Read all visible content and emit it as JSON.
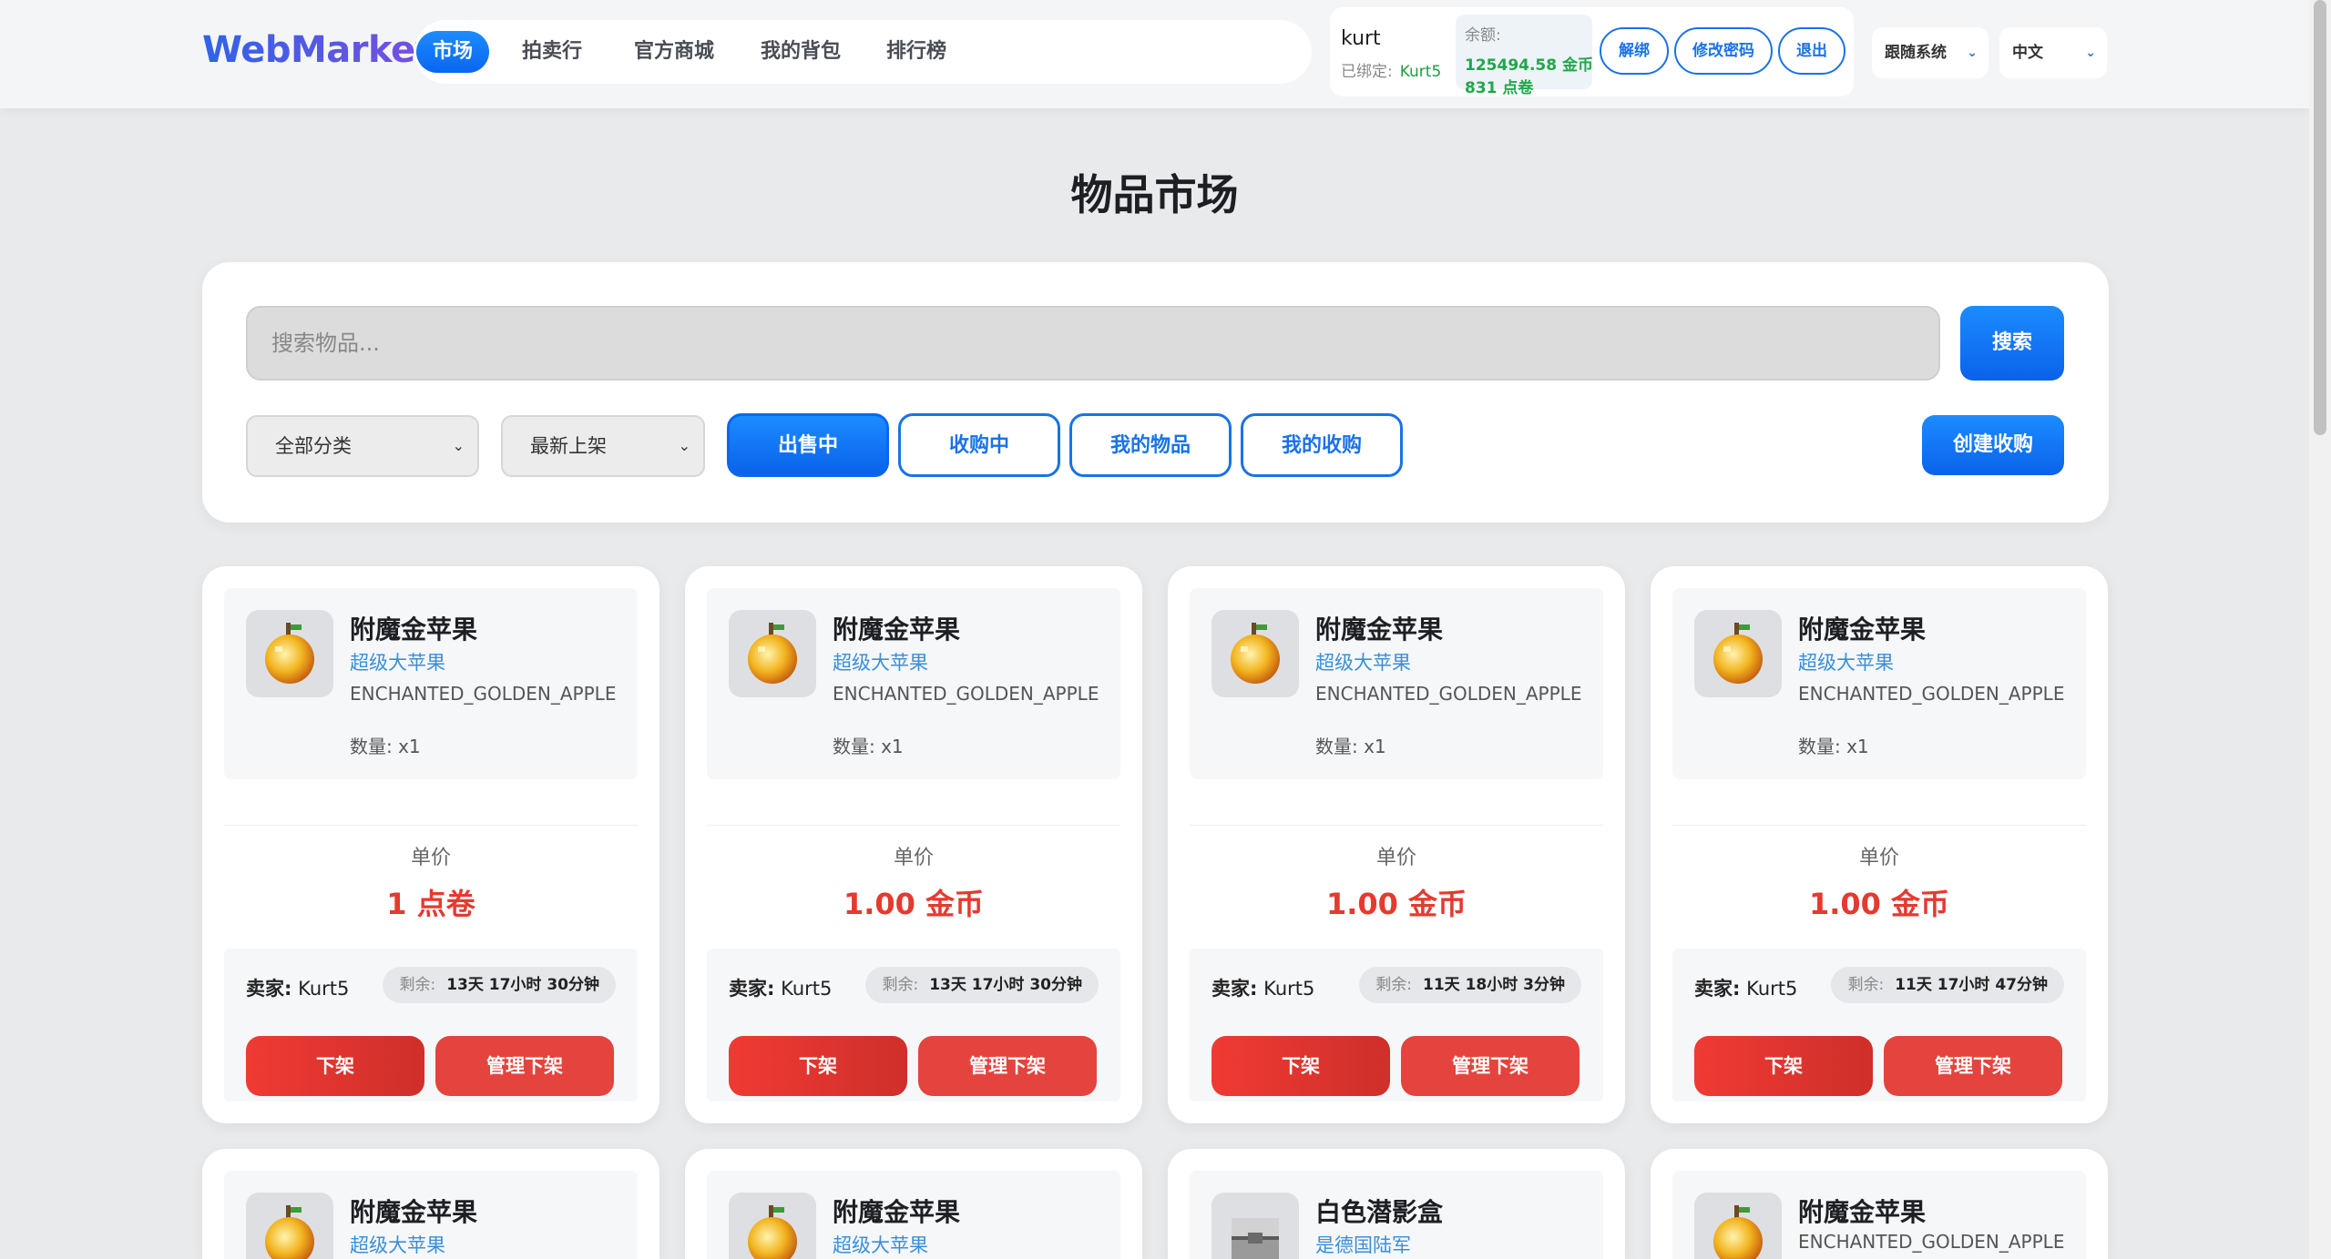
{
  "header": {
    "logo": "WebMarket",
    "nav": [
      {
        "label": "市场",
        "active": true
      },
      {
        "label": "拍卖行",
        "active": false
      },
      {
        "label": "官方商城",
        "active": false
      },
      {
        "label": "我的背包",
        "active": false
      },
      {
        "label": "排行榜",
        "active": false
      }
    ],
    "user": {
      "name": "kurt",
      "bound_label": "已绑定:",
      "bound_value": "Kurt5",
      "balance_label": "余额:",
      "balance_gold": "125494.58 金币",
      "balance_points": "831 点卷"
    },
    "buttons": {
      "unbind": "解绑",
      "change_password": "修改密码",
      "logout": "退出"
    },
    "theme_select": "跟随系统",
    "lang_select": "中文"
  },
  "page_title": "物品市场",
  "search": {
    "placeholder": "搜索物品...",
    "button": "搜索",
    "category": "全部分类",
    "sort": "最新上架",
    "filters": [
      {
        "label": "出售中",
        "active": true
      },
      {
        "label": "收购中",
        "active": false
      },
      {
        "label": "我的物品",
        "active": false
      },
      {
        "label": "我的收购",
        "active": false
      }
    ],
    "create_request": "创建收购"
  },
  "colors": {
    "accent": "#0a66f0",
    "price": "#e53a2f",
    "danger": "#e4443d",
    "success": "#1fa74a",
    "link": "#3a8fd8"
  },
  "cards": [
    {
      "name": "附魔金苹果",
      "sub": "超级大苹果",
      "id": "ENCHANTED_GOLDEN_APPLE",
      "qty": "数量: x1",
      "icon": "golden-apple-icon",
      "price_label": "单价",
      "price": "1 点卷",
      "seller_label": "卖家:",
      "seller": "Kurt5",
      "remain_label": "剩余:",
      "remain": "13天 17小时 30分钟",
      "btn_unlist": "下架",
      "btn_manage": "管理下架"
    },
    {
      "name": "附魔金苹果",
      "sub": "超级大苹果",
      "id": "ENCHANTED_GOLDEN_APPLE",
      "qty": "数量: x1",
      "icon": "golden-apple-icon",
      "price_label": "单价",
      "price": "1.00 金币",
      "seller_label": "卖家:",
      "seller": "Kurt5",
      "remain_label": "剩余:",
      "remain": "13天 17小时 30分钟",
      "btn_unlist": "下架",
      "btn_manage": "管理下架"
    },
    {
      "name": "附魔金苹果",
      "sub": "超级大苹果",
      "id": "ENCHANTED_GOLDEN_APPLE",
      "qty": "数量: x1",
      "icon": "golden-apple-icon",
      "price_label": "单价",
      "price": "1.00 金币",
      "seller_label": "卖家:",
      "seller": "Kurt5",
      "remain_label": "剩余:",
      "remain": "11天 18小时 3分钟",
      "btn_unlist": "下架",
      "btn_manage": "管理下架"
    },
    {
      "name": "附魔金苹果",
      "sub": "超级大苹果",
      "id": "ENCHANTED_GOLDEN_APPLE",
      "qty": "数量: x1",
      "icon": "golden-apple-icon",
      "price_label": "单价",
      "price": "1.00 金币",
      "seller_label": "卖家:",
      "seller": "Kurt5",
      "remain_label": "剩余:",
      "remain": "11天 17小时 47分钟",
      "btn_unlist": "下架",
      "btn_manage": "管理下架"
    },
    {
      "name": "附魔金苹果",
      "sub": "超级大苹果",
      "icon": "golden-apple-icon"
    },
    {
      "name": "附魔金苹果",
      "sub": "超级大苹果",
      "icon": "golden-apple-icon"
    },
    {
      "name": "白色潜影盒",
      "sub": "是德国陆军",
      "icon": "shulker-box-icon"
    },
    {
      "name": "附魔金苹果",
      "sub": "ENCHANTED_GOLDEN_APPLE",
      "icon": "golden-apple-icon"
    }
  ]
}
